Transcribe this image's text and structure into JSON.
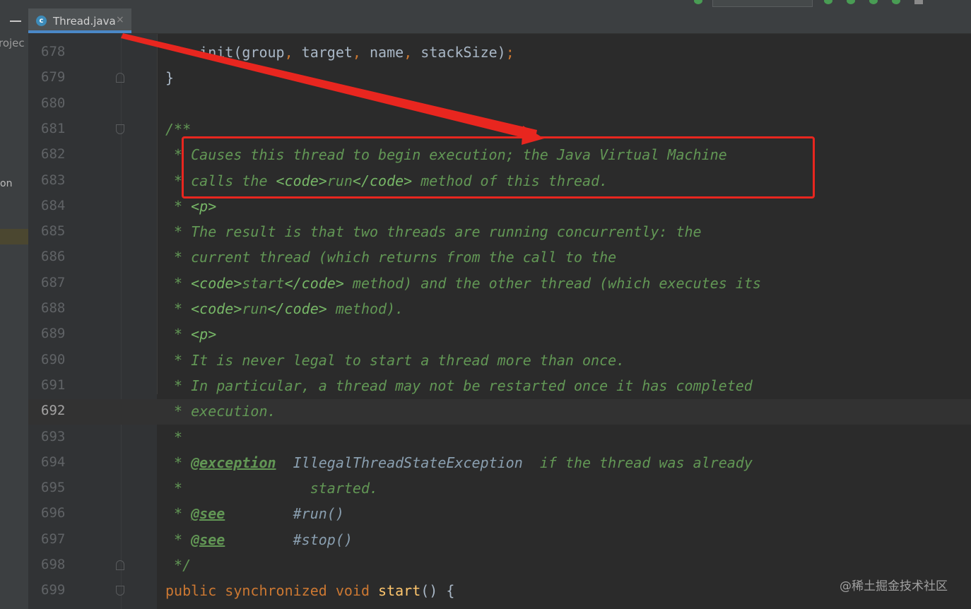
{
  "tab": {
    "title": "Thread.java",
    "icon_letter": "c",
    "close": "×"
  },
  "left_panel": {
    "project_fragment": "rojec",
    "fragment2": "on"
  },
  "colors": {
    "background": "#2b2b2b",
    "doc_comment": "#629755",
    "keyword": "#cc7832",
    "annotation_box": "#e8261f"
  },
  "lines": [
    {
      "num": "678",
      "segments": [
        {
          "t": "    init(group",
          "c": "plain"
        },
        {
          "t": ", ",
          "c": "kw"
        },
        {
          "t": "target",
          "c": "plain"
        },
        {
          "t": ", ",
          "c": "kw"
        },
        {
          "t": "name",
          "c": "plain"
        },
        {
          "t": ", ",
          "c": "kw"
        },
        {
          "t": "stackSize)",
          "c": "plain"
        },
        {
          "t": ";",
          "c": "kw"
        }
      ]
    },
    {
      "num": "679",
      "fold": "end",
      "segments": [
        {
          "t": "}",
          "c": "plain"
        }
      ]
    },
    {
      "num": "680",
      "segments": []
    },
    {
      "num": "681",
      "fold": "start",
      "segments": [
        {
          "t": "/**",
          "c": "doc"
        }
      ]
    },
    {
      "num": "682",
      "segments": [
        {
          "t": " * Causes this thread to begin execution; the Java Virtual Machine",
          "c": "doc"
        }
      ]
    },
    {
      "num": "683",
      "segments": [
        {
          "t": " * calls the ",
          "c": "doc"
        },
        {
          "t": "<code>",
          "c": "tag"
        },
        {
          "t": "run",
          "c": "doc"
        },
        {
          "t": "</code>",
          "c": "tag"
        },
        {
          "t": " method of this thread.",
          "c": "doc"
        }
      ]
    },
    {
      "num": "684",
      "segments": [
        {
          "t": " * ",
          "c": "doc"
        },
        {
          "t": "<p>",
          "c": "tag"
        }
      ]
    },
    {
      "num": "685",
      "segments": [
        {
          "t": " * The result is that two threads are running concurrently: the",
          "c": "doc"
        }
      ]
    },
    {
      "num": "686",
      "segments": [
        {
          "t": " * current thread (which returns from the call to the",
          "c": "doc"
        }
      ]
    },
    {
      "num": "687",
      "segments": [
        {
          "t": " * ",
          "c": "doc"
        },
        {
          "t": "<code>",
          "c": "tag"
        },
        {
          "t": "start",
          "c": "doc"
        },
        {
          "t": "</code>",
          "c": "tag"
        },
        {
          "t": " method) and the other thread (which executes its",
          "c": "doc"
        }
      ]
    },
    {
      "num": "688",
      "segments": [
        {
          "t": " * ",
          "c": "doc"
        },
        {
          "t": "<code>",
          "c": "tag"
        },
        {
          "t": "run",
          "c": "doc"
        },
        {
          "t": "</code>",
          "c": "tag"
        },
        {
          "t": " method).",
          "c": "doc"
        }
      ]
    },
    {
      "num": "689",
      "segments": [
        {
          "t": " * ",
          "c": "doc"
        },
        {
          "t": "<p>",
          "c": "tag"
        }
      ]
    },
    {
      "num": "690",
      "segments": [
        {
          "t": " * It is never legal to start a thread more than once.",
          "c": "doc"
        }
      ]
    },
    {
      "num": "691",
      "segments": [
        {
          "t": " * In particular, a thread may not be restarted once it has completed",
          "c": "doc"
        }
      ]
    },
    {
      "num": "692",
      "current": true,
      "segments": [
        {
          "t": " * execution.",
          "c": "doc"
        }
      ]
    },
    {
      "num": "693",
      "segments": [
        {
          "t": " *",
          "c": "doc"
        }
      ]
    },
    {
      "num": "694",
      "segments": [
        {
          "t": " * ",
          "c": "doc"
        },
        {
          "t": "@exception",
          "c": "dtag"
        },
        {
          "t": "  IllegalThreadStateException",
          "c": "plaindoc"
        },
        {
          "t": "  if the thread was already",
          "c": "doc"
        }
      ]
    },
    {
      "num": "695",
      "segments": [
        {
          "t": " *               started.",
          "c": "doc"
        }
      ]
    },
    {
      "num": "696",
      "segments": [
        {
          "t": " * ",
          "c": "doc"
        },
        {
          "t": "@see",
          "c": "dtag"
        },
        {
          "t": "        #run()",
          "c": "plaindoc"
        }
      ]
    },
    {
      "num": "697",
      "segments": [
        {
          "t": " * ",
          "c": "doc"
        },
        {
          "t": "@see",
          "c": "dtag"
        },
        {
          "t": "        #stop()",
          "c": "plaindoc"
        }
      ]
    },
    {
      "num": "698",
      "fold": "end",
      "segments": [
        {
          "t": " */",
          "c": "doc"
        }
      ]
    },
    {
      "num": "699",
      "fold": "start",
      "segments": [
        {
          "t": "public synchronized void ",
          "c": "kw"
        },
        {
          "t": "start",
          "c": "fn"
        },
        {
          "t": "() {",
          "c": "plain"
        }
      ]
    }
  ],
  "watermark": "@稀土掘金技术社区"
}
